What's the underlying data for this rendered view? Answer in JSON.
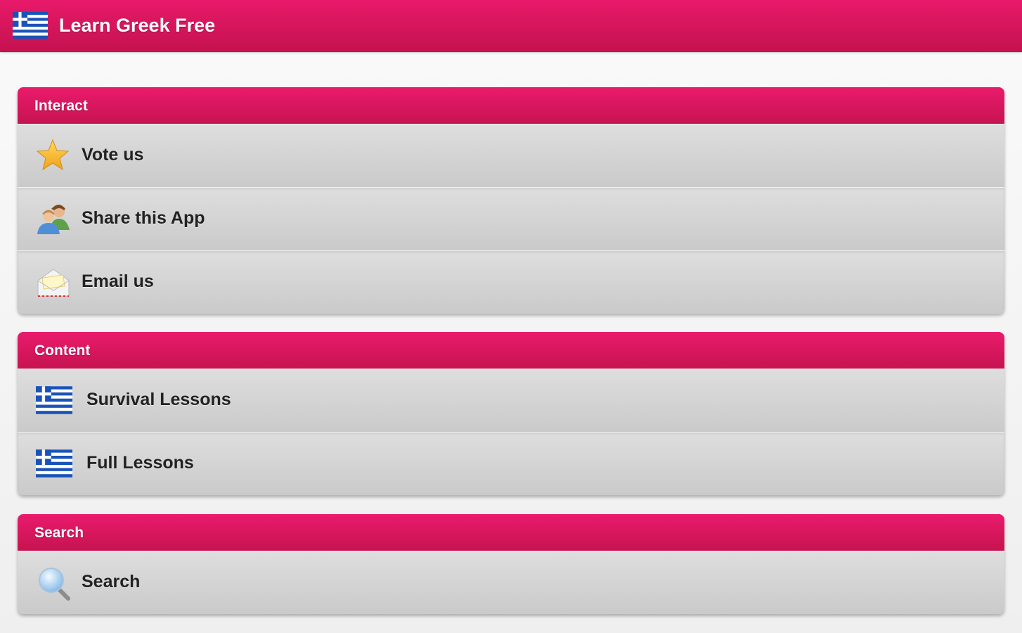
{
  "app": {
    "title": "Learn Greek Free",
    "accent_color": "#e0155f"
  },
  "sections": [
    {
      "title": "Interact",
      "items": [
        {
          "label": "Vote us",
          "icon": "star-icon"
        },
        {
          "label": "Share this App",
          "icon": "users-icon"
        },
        {
          "label": "Email us",
          "icon": "envelope-icon"
        }
      ]
    },
    {
      "title": "Content",
      "items": [
        {
          "label": "Survival Lessons",
          "icon": "greek-flag-icon"
        },
        {
          "label": "Full Lessons",
          "icon": "greek-flag-icon"
        }
      ]
    },
    {
      "title": "Search",
      "items": [
        {
          "label": "Search",
          "icon": "magnifier-icon"
        }
      ]
    }
  ]
}
